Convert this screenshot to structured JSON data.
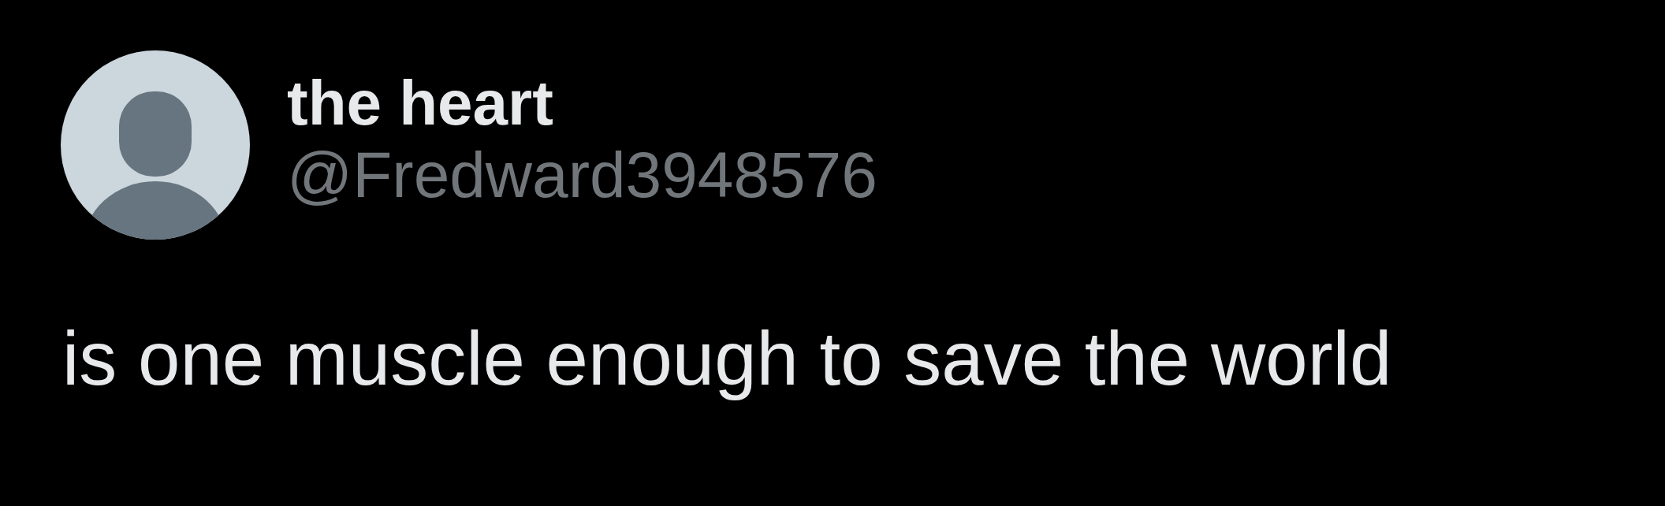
{
  "author": {
    "name": "the heart",
    "handle": "@Fredward3948576"
  },
  "post": {
    "text": "is one muscle enough to save the world"
  }
}
